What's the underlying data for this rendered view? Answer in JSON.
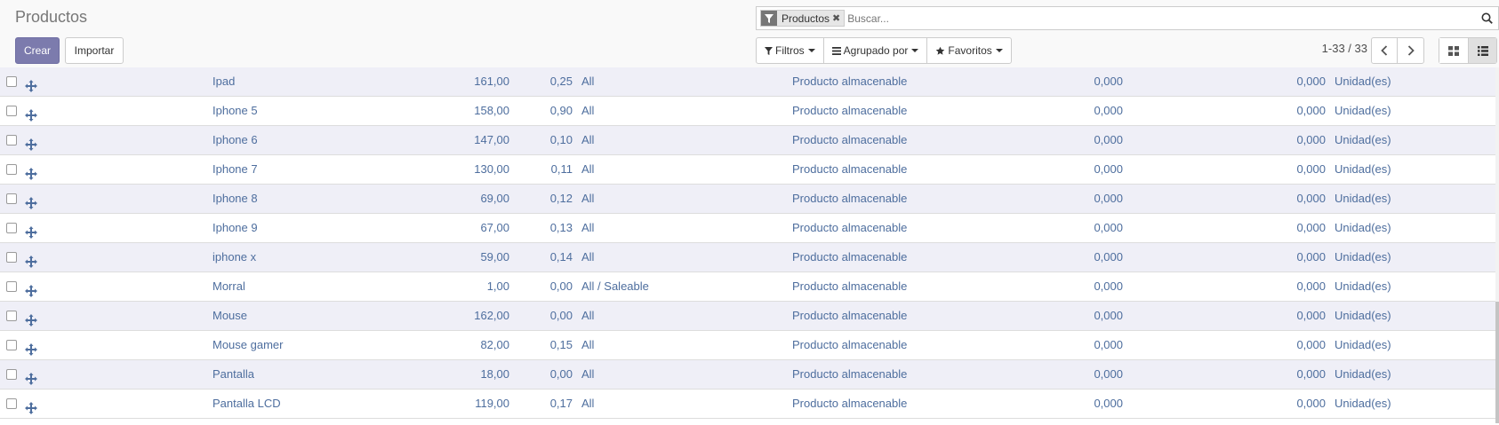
{
  "header": {
    "title": "Productos",
    "create_label": "Crear",
    "import_label": "Importar"
  },
  "search": {
    "facet_label": "Productos",
    "placeholder": "Buscar..."
  },
  "toolbar": {
    "filters_label": "Filtros",
    "group_by_label": "Agrupado por",
    "favorites_label": "Favoritos"
  },
  "pager": {
    "value": "1-33 / 33"
  },
  "colors": {
    "primary": "#7c7bad",
    "link_text": "#4e6e9e",
    "row_odd": "#efeff7"
  },
  "rows": [
    {
      "name": "Ipad",
      "price": "161,00",
      "weight": "0,25",
      "category": "All",
      "type": "Producto almacenable",
      "on_hand": "0,000",
      "forecast": "0,000",
      "uom": "Unidad(es)"
    },
    {
      "name": "Iphone 5",
      "price": "158,00",
      "weight": "0,90",
      "category": "All",
      "type": "Producto almacenable",
      "on_hand": "0,000",
      "forecast": "0,000",
      "uom": "Unidad(es)"
    },
    {
      "name": "Iphone 6",
      "price": "147,00",
      "weight": "0,10",
      "category": "All",
      "type": "Producto almacenable",
      "on_hand": "0,000",
      "forecast": "0,000",
      "uom": "Unidad(es)"
    },
    {
      "name": "Iphone 7",
      "price": "130,00",
      "weight": "0,11",
      "category": "All",
      "type": "Producto almacenable",
      "on_hand": "0,000",
      "forecast": "0,000",
      "uom": "Unidad(es)"
    },
    {
      "name": "Iphone 8",
      "price": "69,00",
      "weight": "0,12",
      "category": "All",
      "type": "Producto almacenable",
      "on_hand": "0,000",
      "forecast": "0,000",
      "uom": "Unidad(es)"
    },
    {
      "name": "Iphone 9",
      "price": "67,00",
      "weight": "0,13",
      "category": "All",
      "type": "Producto almacenable",
      "on_hand": "0,000",
      "forecast": "0,000",
      "uom": "Unidad(es)"
    },
    {
      "name": "iphone x",
      "price": "59,00",
      "weight": "0,14",
      "category": "All",
      "type": "Producto almacenable",
      "on_hand": "0,000",
      "forecast": "0,000",
      "uom": "Unidad(es)"
    },
    {
      "name": "Morral",
      "price": "1,00",
      "weight": "0,00",
      "category": "All / Saleable",
      "type": "Producto almacenable",
      "on_hand": "0,000",
      "forecast": "0,000",
      "uom": "Unidad(es)"
    },
    {
      "name": "Mouse",
      "price": "162,00",
      "weight": "0,00",
      "category": "All",
      "type": "Producto almacenable",
      "on_hand": "0,000",
      "forecast": "0,000",
      "uom": "Unidad(es)"
    },
    {
      "name": "Mouse gamer",
      "price": "82,00",
      "weight": "0,15",
      "category": "All",
      "type": "Producto almacenable",
      "on_hand": "0,000",
      "forecast": "0,000",
      "uom": "Unidad(es)"
    },
    {
      "name": "Pantalla",
      "price": "18,00",
      "weight": "0,00",
      "category": "All",
      "type": "Producto almacenable",
      "on_hand": "0,000",
      "forecast": "0,000",
      "uom": "Unidad(es)"
    },
    {
      "name": "Pantalla LCD",
      "price": "119,00",
      "weight": "0,17",
      "category": "All",
      "type": "Producto almacenable",
      "on_hand": "0,000",
      "forecast": "0,000",
      "uom": "Unidad(es)"
    }
  ]
}
